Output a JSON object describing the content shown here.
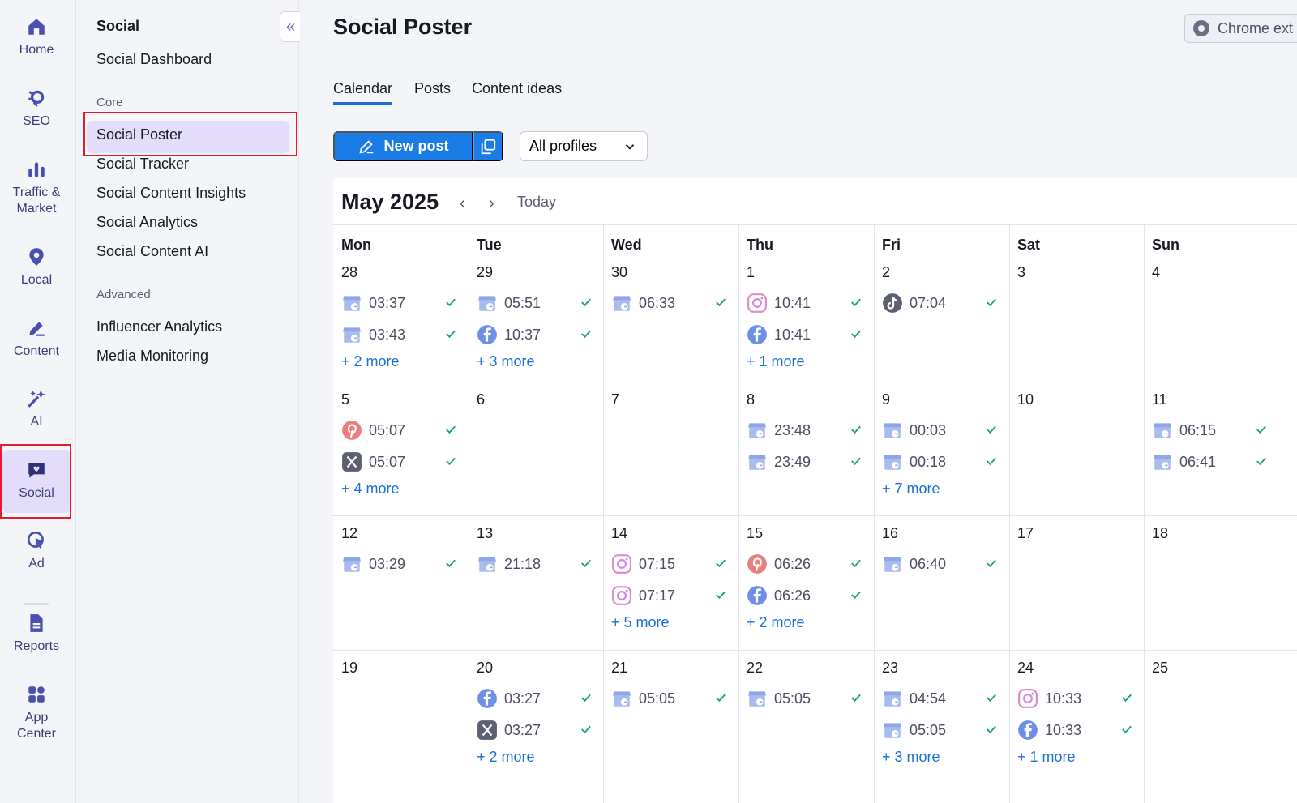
{
  "rail": {
    "items": [
      {
        "label": "Home",
        "icon": "home-icon"
      },
      {
        "label": "SEO",
        "icon": "seo-icon"
      },
      {
        "label": "Traffic & Market",
        "icon": "traffic-market-icon"
      },
      {
        "label": "Local",
        "icon": "location-pin-icon"
      },
      {
        "label": "Content",
        "icon": "pen-icon"
      },
      {
        "label": "AI",
        "icon": "sparkles-icon"
      },
      {
        "label": "Social",
        "icon": "chat-heart-icon"
      },
      {
        "label": "Ad",
        "icon": "ad-cursor-icon"
      },
      {
        "label": "Reports",
        "icon": "document-icon"
      },
      {
        "label": "App Center",
        "icon": "apps-grid-icon"
      }
    ],
    "active": "Social"
  },
  "subnav": {
    "title": "Social",
    "dashboard": "Social Dashboard",
    "core_label": "Core",
    "core_items": [
      "Social Poster",
      "Social Tracker",
      "Social Content Insights",
      "Social Analytics",
      "Social Content AI"
    ],
    "advanced_label": "Advanced",
    "advanced_items": [
      "Influencer Analytics",
      "Media Monitoring"
    ],
    "collapse_glyph": "«"
  },
  "header": {
    "title": "Social Poster",
    "chrome_button": "Chrome ext"
  },
  "tabs": [
    "Calendar",
    "Posts",
    "Content ideas"
  ],
  "toolbar": {
    "new_post": "New post",
    "profiles": "All profiles"
  },
  "calendar": {
    "month": "May 2025",
    "today": "Today",
    "prev": "‹",
    "next": "›",
    "weekdays": [
      "Mon",
      "Tue",
      "Wed",
      "Thu",
      "Fri",
      "Sat",
      "Sun"
    ],
    "weeks": [
      [
        {
          "day": "28",
          "posts": [
            {
              "net": "gmb",
              "time": "03:37"
            },
            {
              "net": "gmb",
              "time": "03:43"
            }
          ],
          "more": "+ 2 more"
        },
        {
          "day": "29",
          "posts": [
            {
              "net": "gmb",
              "time": "05:51"
            },
            {
              "net": "facebook",
              "time": "10:37"
            }
          ],
          "more": "+ 3 more"
        },
        {
          "day": "30",
          "posts": [
            {
              "net": "gmb",
              "time": "06:33"
            }
          ],
          "more": ""
        },
        {
          "day": "1",
          "posts": [
            {
              "net": "instagram",
              "time": "10:41"
            },
            {
              "net": "facebook",
              "time": "10:41"
            }
          ],
          "more": "+ 1 more"
        },
        {
          "day": "2",
          "posts": [
            {
              "net": "tiktok",
              "time": "07:04"
            }
          ],
          "more": ""
        },
        {
          "day": "3",
          "posts": [],
          "more": ""
        },
        {
          "day": "4",
          "posts": [],
          "more": ""
        }
      ],
      [
        {
          "day": "5",
          "posts": [
            {
              "net": "pinterest",
              "time": "05:07"
            },
            {
              "net": "x",
              "time": "05:07"
            }
          ],
          "more": "+ 4 more"
        },
        {
          "day": "6",
          "posts": [],
          "more": ""
        },
        {
          "day": "7",
          "posts": [],
          "more": ""
        },
        {
          "day": "8",
          "posts": [
            {
              "net": "gmb",
              "time": "23:48"
            },
            {
              "net": "gmb",
              "time": "23:49"
            }
          ],
          "more": ""
        },
        {
          "day": "9",
          "posts": [
            {
              "net": "gmb",
              "time": "00:03"
            },
            {
              "net": "gmb",
              "time": "00:18"
            }
          ],
          "more": "+ 7 more"
        },
        {
          "day": "10",
          "posts": [],
          "more": ""
        },
        {
          "day": "11",
          "posts": [
            {
              "net": "gmb",
              "time": "06:15"
            },
            {
              "net": "gmb",
              "time": "06:41"
            }
          ],
          "more": ""
        }
      ],
      [
        {
          "day": "12",
          "posts": [
            {
              "net": "gmb",
              "time": "03:29"
            }
          ],
          "more": ""
        },
        {
          "day": "13",
          "posts": [
            {
              "net": "gmb",
              "time": "21:18"
            }
          ],
          "more": ""
        },
        {
          "day": "14",
          "posts": [
            {
              "net": "instagram",
              "time": "07:15"
            },
            {
              "net": "instagram",
              "time": "07:17"
            }
          ],
          "more": "+ 5 more"
        },
        {
          "day": "15",
          "posts": [
            {
              "net": "pinterest",
              "time": "06:26"
            },
            {
              "net": "facebook",
              "time": "06:26"
            }
          ],
          "more": "+ 2 more"
        },
        {
          "day": "16",
          "posts": [
            {
              "net": "gmb",
              "time": "06:40"
            }
          ],
          "more": ""
        },
        {
          "day": "17",
          "posts": [],
          "more": ""
        },
        {
          "day": "18",
          "posts": [],
          "more": ""
        }
      ],
      [
        {
          "day": "19",
          "posts": [],
          "more": ""
        },
        {
          "day": "20",
          "posts": [
            {
              "net": "facebook",
              "time": "03:27"
            },
            {
              "net": "x",
              "time": "03:27"
            }
          ],
          "more": "+ 2 more"
        },
        {
          "day": "21",
          "posts": [
            {
              "net": "gmb",
              "time": "05:05"
            }
          ],
          "more": ""
        },
        {
          "day": "22",
          "posts": [
            {
              "net": "gmb",
              "time": "05:05"
            }
          ],
          "more": ""
        },
        {
          "day": "23",
          "posts": [
            {
              "net": "gmb",
              "time": "04:54"
            },
            {
              "net": "gmb",
              "time": "05:05"
            }
          ],
          "more": "+ 3 more"
        },
        {
          "day": "24",
          "posts": [
            {
              "net": "instagram",
              "time": "10:33"
            },
            {
              "net": "facebook",
              "time": "10:33"
            }
          ],
          "more": "+ 1 more"
        },
        {
          "day": "25",
          "posts": [],
          "more": ""
        }
      ]
    ]
  },
  "colors": {
    "accent": "#1a7de6",
    "active_nav": "#e3dcfb",
    "check": "#1aa37a",
    "link": "#1a6fd8",
    "highlight_box": "#e11d2e"
  }
}
